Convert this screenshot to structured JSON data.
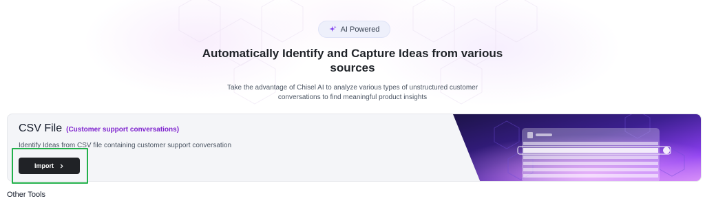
{
  "badge": {
    "label": "AI Powered",
    "icon": "sparkle-icon"
  },
  "hero": {
    "title": "Automatically Identify and Capture Ideas from various sources",
    "subtitle": "Take the advantage of Chisel AI to analyze various types of unstructured customer conversations to find meaningful product insights"
  },
  "card": {
    "title": "CSV File",
    "tag": "(Customer support conversations)",
    "description": "Identify Ideas from CSV file containing customer support conversation",
    "import_label": "Import",
    "import_icon": "chevron-right-icon"
  },
  "section": {
    "other_tools": "Other Tools"
  },
  "colors": {
    "accent_purple": "#7e22ce",
    "button_dark": "#202226",
    "highlight_green": "#22b04b"
  }
}
